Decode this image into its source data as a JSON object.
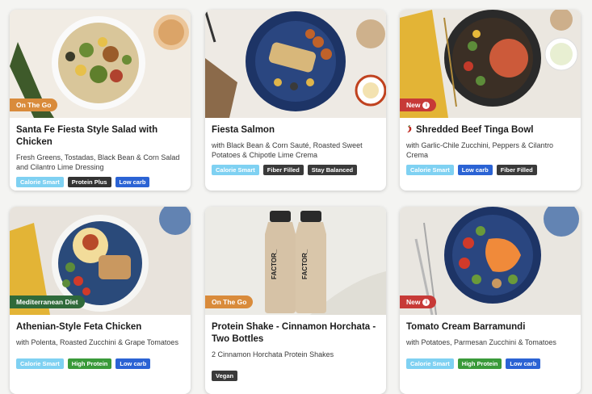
{
  "colors": {
    "calorie_smart": "#7fd1f2",
    "protein_plus": "#333333",
    "low_carb": "#2b63d4",
    "fiber_filled": "#3a3a3a",
    "stay_balanced": "#3a3a3a",
    "high_protein": "#3a9a3a",
    "vegan": "#3a3a3a",
    "badge_on_the_go": "#d98b3b",
    "badge_new": "#c73a37",
    "badge_mediterranean": "#2f6a3a"
  },
  "cards": [
    {
      "title": "Santa Fe Fiesta Style Salad with Chicken",
      "description": "Fresh Greens, Tostadas, Black Bean & Corn Salad and Cilantro Lime Dressing",
      "badge": "On The Go",
      "tags": [
        "Calorie Smart",
        "Protein Plus",
        "Low carb"
      ]
    },
    {
      "title": "Fiesta Salmon",
      "description": "with Black Bean & Corn Sauté, Roasted Sweet Potatoes & Chipotle Lime Crema",
      "badge": "",
      "tags": [
        "Calorie Smart",
        "Fiber Filled",
        "Stay Balanced"
      ]
    },
    {
      "title": "Shredded Beef Tinga Bowl",
      "description": "with Garlic-Chile Zucchini, Peppers & Cilantro Crema",
      "badge": "New",
      "tags": [
        "Calorie Smart",
        "Low carb",
        "Fiber Filled"
      ],
      "title_icon": "chili-pepper-icon"
    },
    {
      "title": "Athenian-Style Feta Chicken",
      "description": "with Polenta, Roasted Zucchini & Grape Tomatoes",
      "badge": "Mediterranean Diet",
      "tags": [
        "Calorie Smart",
        "High Protein",
        "Low carb"
      ]
    },
    {
      "title": "Protein Shake - Cinnamon Horchata - Two Bottles",
      "description": "2 Cinnamon Horchata Protein Shakes",
      "badge": "On The Go",
      "tags": [
        "Vegan"
      ],
      "bottle_label": "FACTOR_"
    },
    {
      "title": "Tomato Cream Barramundi",
      "description": "with Potatoes, Parmesan Zucchini & Tomatoes",
      "badge": "New",
      "tags": [
        "Calorie Smart",
        "High Protein",
        "Low carb"
      ]
    }
  ]
}
